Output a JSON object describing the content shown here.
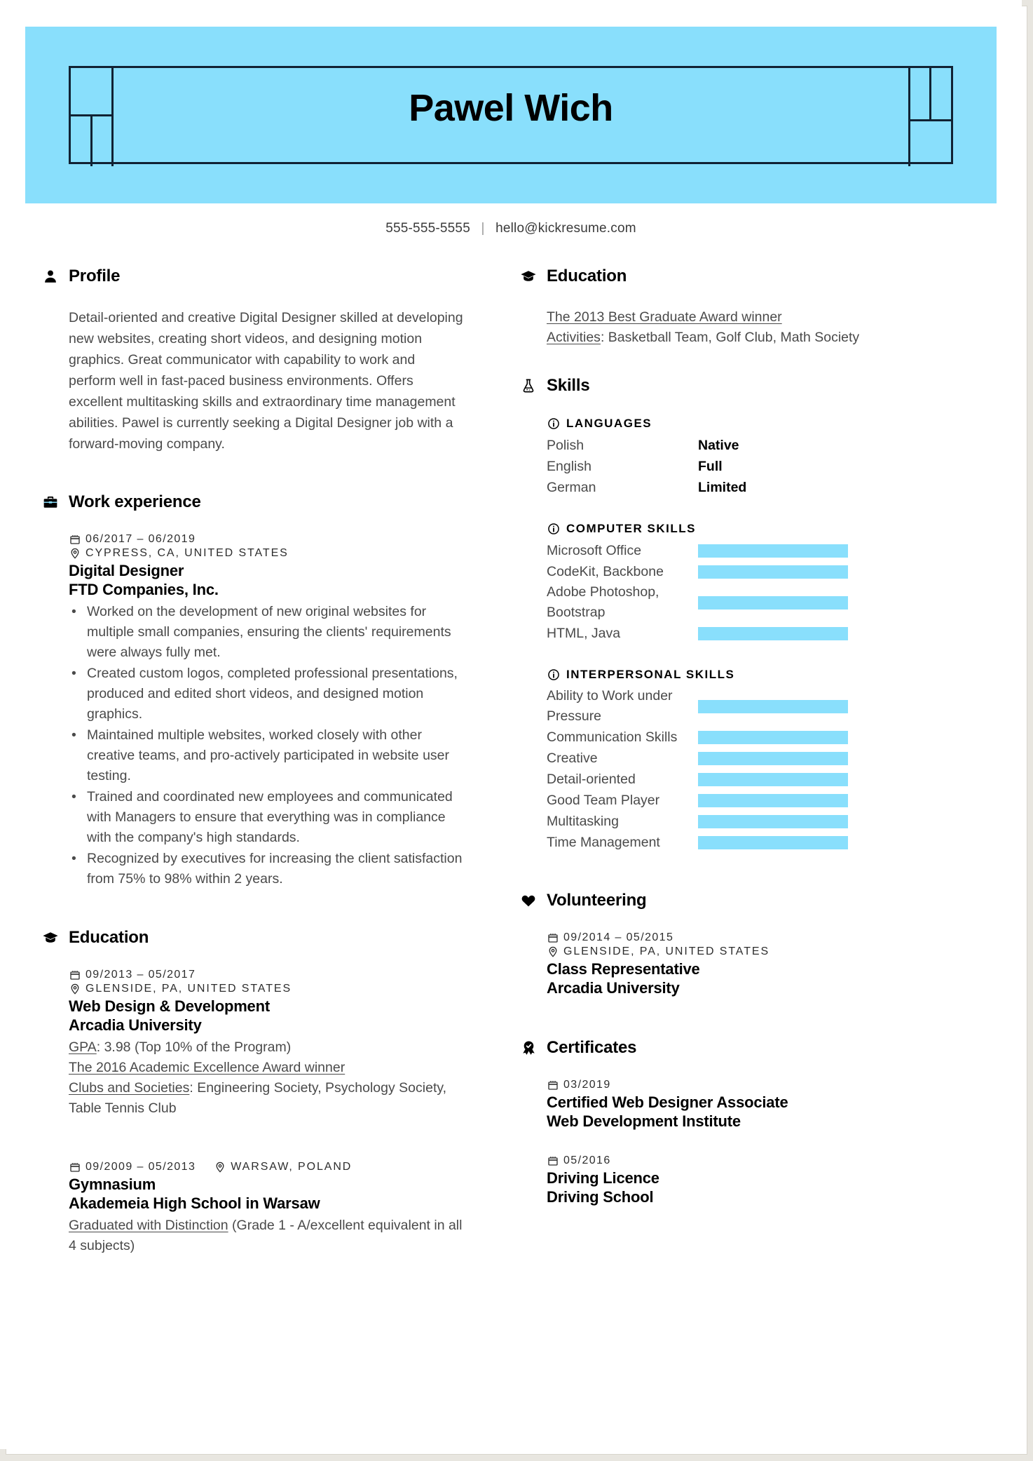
{
  "theme": {
    "accent": "#89dffc",
    "ink": "#000000",
    "body_text": "#4a4a4a",
    "frame": "#112233",
    "page_bg": "#ffffff",
    "canvas_bg": "#e8e6e0"
  },
  "header": {
    "name": "Pawel Wich",
    "phone": "555-555-5555",
    "separator": "|",
    "email": "hello@kickresume.com"
  },
  "left_column": {
    "profile": {
      "icon": "person-icon",
      "title": "Profile",
      "text": "Detail-oriented and creative Digital Designer skilled at developing new websites, creating short videos, and designing motion graphics. Great communicator with capability to work and perform well in fast-paced business environments. Offers excellent multitasking skills and extraordinary time management abilities. Pawel is currently seeking a Digital Designer job with a forward-moving company."
    },
    "work_experience": {
      "icon": "briefcase-icon",
      "title": "Work experience",
      "entries": [
        {
          "date": "06/2017 – 06/2019",
          "location": "CYPRESS, CA, UNITED STATES",
          "position": "Digital Designer",
          "organization": "FTD Companies, Inc.",
          "bullets": [
            "Worked on the development of new original websites for multiple small companies, ensuring the clients' requirements were always fully met.",
            "Created custom logos, completed professional presentations, produced and edited short videos, and designed motion graphics.",
            "Maintained multiple websites, worked closely with other creative teams, and pro-actively participated in website user testing.",
            "Trained and coordinated new employees and communicated with Managers to ensure that everything was in compliance with the company's high standards.",
            "Recognized by executives for increasing the client satisfaction from 75% to 98% within 2 years."
          ]
        }
      ]
    },
    "education": {
      "icon": "graduation-cap-icon",
      "title": "Education",
      "entries": [
        {
          "date": "09/2013 – 05/2017",
          "location": "GLENSIDE, PA, UNITED STATES",
          "inline_meta": false,
          "degree": "Web Design & Development",
          "school": "Arcadia University",
          "details": [
            {
              "label": "GPA",
              "rest": ": 3.98 (Top 10% of the Program)"
            },
            {
              "label": "The 2016 Academic Excellence Award winner",
              "rest": ""
            },
            {
              "label": "Clubs and Societies",
              "rest": ": Engineering Society, Psychology Society, Table Tennis Club"
            }
          ]
        },
        {
          "date": "09/2009 – 05/2013",
          "location": "WARSAW, POLAND",
          "inline_meta": true,
          "degree": "Gymnasium",
          "school": "Akademeia High School in Warsaw",
          "details": [
            {
              "label": "Graduated with Distinction",
              "rest": " (Grade 1 - A/excellent equivalent in all 4 subjects)"
            }
          ]
        }
      ]
    }
  },
  "right_column": {
    "education_top": {
      "icon": "graduation-cap-icon",
      "title": "Education",
      "details": [
        {
          "label": "The 2013 Best Graduate Award winner",
          "rest": ""
        },
        {
          "label": "Activities",
          "rest": ": Basketball Team, Golf Club, Math Society"
        }
      ]
    },
    "skills": {
      "icon": "flask-icon",
      "title": "Skills",
      "groups": [
        {
          "icon": "info-circle-icon",
          "title": "LANGUAGES",
          "type": "languages",
          "items": [
            {
              "name": "Polish",
              "level": "Native"
            },
            {
              "name": "English",
              "level": "Full"
            },
            {
              "name": "German",
              "level": "Limited"
            }
          ]
        },
        {
          "icon": "info-circle-icon",
          "title": "COMPUTER SKILLS",
          "type": "bars",
          "items": [
            {
              "name": "Microsoft Office",
              "value": 80
            },
            {
              "name": "CodeKit, Backbone",
              "value": 100
            },
            {
              "name": "Adobe Photoshop, Bootstrap",
              "value": 80
            },
            {
              "name": "HTML, Java",
              "value": 80
            }
          ]
        },
        {
          "icon": "info-circle-icon",
          "title": "INTERPERSONAL SKILLS",
          "type": "bars",
          "items": [
            {
              "name": "Ability to Work under Pressure",
              "value": 80
            },
            {
              "name": "Communication Skills",
              "value": 100
            },
            {
              "name": "Creative",
              "value": 100
            },
            {
              "name": "Detail-oriented",
              "value": 80
            },
            {
              "name": "Good Team Player",
              "value": 100
            },
            {
              "name": "Multitasking",
              "value": 100
            },
            {
              "name": "Time Management",
              "value": 80
            }
          ]
        }
      ]
    },
    "volunteering": {
      "icon": "heart-icon",
      "title": "Volunteering",
      "entries": [
        {
          "date": "09/2014 – 05/2015",
          "location": "GLENSIDE, PA, UNITED STATES",
          "position": "Class Representative",
          "organization": "Arcadia University"
        }
      ]
    },
    "certificates": {
      "icon": "award-ribbon-icon",
      "title": "Certificates",
      "entries": [
        {
          "date": "03/2019",
          "position": "Certified Web Designer Associate",
          "organization": "Web Development Institute"
        },
        {
          "date": "05/2016",
          "position": "Driving Licence",
          "organization": "Driving School"
        }
      ]
    }
  }
}
